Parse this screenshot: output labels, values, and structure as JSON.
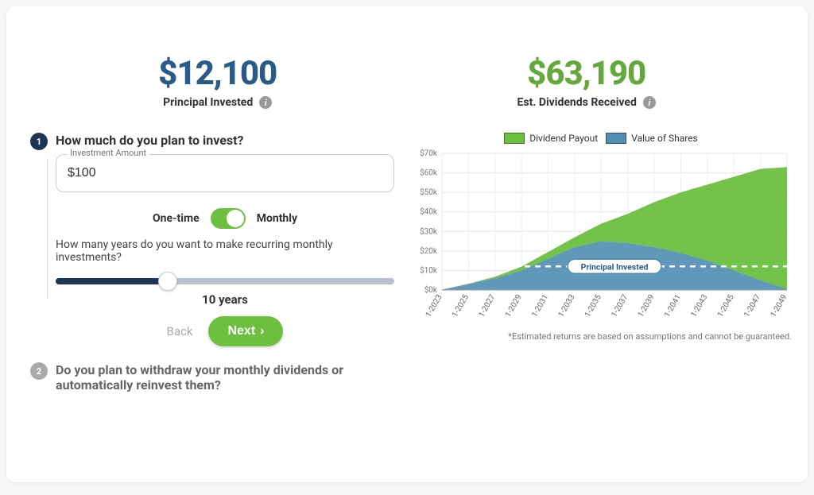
{
  "summary": {
    "principal_value": "$12,100",
    "principal_label": "Principal Invested",
    "dividends_value": "$63,190",
    "dividends_label": "Est. Dividends Received"
  },
  "step1": {
    "title": "How much do you plan to invest?",
    "field_label": "Investment Amount",
    "amount_value": "$100",
    "toggle_left": "One-time",
    "toggle_right": "Monthly",
    "subquestion": "How many years do you want to make recurring monthly investments?",
    "slider_display": "10 years",
    "back_label": "Back",
    "next_label": "Next"
  },
  "step2": {
    "title": "Do you plan to withdraw your monthly dividends or automatically reinvest them?"
  },
  "legend": {
    "payout": "Dividend Payout",
    "value_shares": "Value of Shares"
  },
  "chart": {
    "annotation": "Principal Invested",
    "footnote": "*Estimated returns are based on assumptions and cannot be guaranteed."
  },
  "icons": {
    "info": "i",
    "chevron": "›"
  },
  "chart_data": {
    "type": "area",
    "stacked": true,
    "xlabel": "",
    "ylabel": "",
    "ylim": [
      0,
      70000
    ],
    "y_ticks": [
      "$0k",
      "$10k",
      "$20k",
      "$30k",
      "$40k",
      "$50k",
      "$60k",
      "$70k"
    ],
    "categories": [
      "1-2023",
      "1-2025",
      "1-2027",
      "1-2029",
      "1-2031",
      "1-2033",
      "1-2035",
      "1-2037",
      "1-2039",
      "1-2041",
      "1-2043",
      "1-2045",
      "1-2047",
      "1-2049"
    ],
    "series": [
      {
        "name": "Value of Shares",
        "color": "#4f8db3",
        "values": [
          200,
          3000,
          6000,
          10000,
          16000,
          22000,
          25000,
          24000,
          22000,
          19000,
          15000,
          10000,
          5000,
          500
        ]
      },
      {
        "name": "Dividend Payout",
        "color": "#6cbf3f",
        "values": [
          0,
          200,
          800,
          2000,
          3500,
          5000,
          9000,
          15000,
          23000,
          31000,
          39000,
          48000,
          57000,
          62500
        ]
      }
    ],
    "reference_line": {
      "label": "Principal Invested",
      "value": 12100
    }
  }
}
